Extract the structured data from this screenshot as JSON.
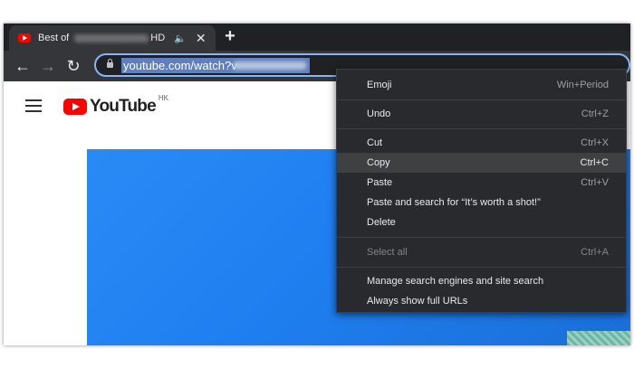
{
  "tab": {
    "title_prefix": "Best of",
    "title_suffix": "HD",
    "speaker_glyph": "🔈",
    "close_glyph": "✕"
  },
  "new_tab_glyph": "+",
  "nav": {
    "back_glyph": "←",
    "forward_glyph": "→",
    "reload_glyph": "↻"
  },
  "omnibox": {
    "url": "youtube.com/watch?v"
  },
  "youtube": {
    "wordmark": "YouTube",
    "region": "HK"
  },
  "context_menu": {
    "items": [
      {
        "label": "Emoji",
        "shortcut": "Win+Period"
      },
      {
        "label": "Undo",
        "shortcut": "Ctrl+Z"
      },
      {
        "label": "Cut",
        "shortcut": "Ctrl+X"
      },
      {
        "label": "Copy",
        "shortcut": "Ctrl+C"
      },
      {
        "label": "Paste",
        "shortcut": "Ctrl+V"
      },
      {
        "label": "Paste and search for “It’s worth a shot!”",
        "shortcut": ""
      },
      {
        "label": "Delete",
        "shortcut": ""
      },
      {
        "label": "Select all",
        "shortcut": "Ctrl+A"
      },
      {
        "label": "Manage search engines and site search",
        "shortcut": ""
      },
      {
        "label": "Always show full URLs",
        "shortcut": ""
      }
    ]
  },
  "colors": {
    "tab_strip": "#202124",
    "toolbar": "#35363a",
    "omnibox_focus": "#8ab4f8",
    "menu_bg": "#292a2d",
    "menu_highlight": "#3f4042",
    "youtube_red": "#ff0000"
  }
}
